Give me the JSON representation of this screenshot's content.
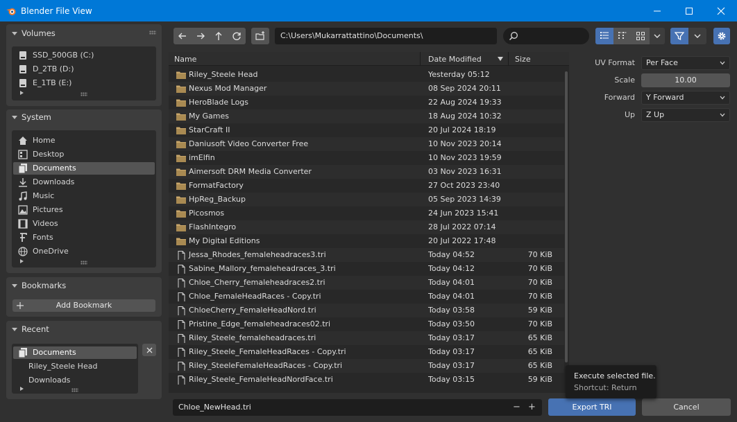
{
  "window": {
    "title": "Blender File View",
    "minimize": "—",
    "maximize": "☐",
    "close": "✕"
  },
  "volumes": {
    "header": "Volumes",
    "items": [
      "SSD_500GB (C:)",
      "D_2TB (D:)",
      "E_1TB (E:)"
    ]
  },
  "system": {
    "header": "System",
    "items": [
      {
        "label": "Home",
        "icon": "home-icon"
      },
      {
        "label": "Desktop",
        "icon": "desktop-icon"
      },
      {
        "label": "Documents",
        "icon": "documents-icon"
      },
      {
        "label": "Downloads",
        "icon": "downloads-icon"
      },
      {
        "label": "Music",
        "icon": "music-icon"
      },
      {
        "label": "Pictures",
        "icon": "pictures-icon"
      },
      {
        "label": "Videos",
        "icon": "videos-icon"
      },
      {
        "label": "Fonts",
        "icon": "fonts-icon"
      },
      {
        "label": "OneDrive",
        "icon": "onedrive-icon"
      }
    ],
    "active_index": 2
  },
  "bookmarks": {
    "header": "Bookmarks",
    "add_label": "Add Bookmark"
  },
  "recent": {
    "header": "Recent",
    "items": [
      "Documents",
      "Riley_Steele  Head",
      "Downloads"
    ]
  },
  "toolbar": {
    "path": "C:\\Users\\Mukarrattattino\\Documents\\",
    "search_placeholder": ""
  },
  "columns": {
    "name": "Name",
    "date": "Date Modified",
    "size": "Size"
  },
  "files": [
    {
      "name": "Riley_Steele  Head",
      "date": "Yesterday 05:12",
      "size": "",
      "folder": true
    },
    {
      "name": "Nexus Mod Manager",
      "date": "08 Sep 2024 20:11",
      "size": "",
      "folder": true
    },
    {
      "name": "HeroBlade Logs",
      "date": "22 Aug 2024 19:33",
      "size": "",
      "folder": true
    },
    {
      "name": "My Games",
      "date": "18 Aug 2024 10:32",
      "size": "",
      "folder": true
    },
    {
      "name": "StarCraft II",
      "date": "20 Jul 2024 18:19",
      "size": "",
      "folder": true
    },
    {
      "name": "Daniusoft Video Converter Free",
      "date": "10 Nov 2023 20:14",
      "size": "",
      "folder": true
    },
    {
      "name": "imElfin",
      "date": "10 Nov 2023 19:59",
      "size": "",
      "folder": true
    },
    {
      "name": "Aimersoft DRM Media Converter",
      "date": "03 Nov 2023 16:31",
      "size": "",
      "folder": true
    },
    {
      "name": "FormatFactory",
      "date": "27 Oct 2023 23:40",
      "size": "",
      "folder": true
    },
    {
      "name": "HpReg_Backup",
      "date": "05 Sep 2023 14:39",
      "size": "",
      "folder": true
    },
    {
      "name": "Picosmos",
      "date": "24 Jun 2023 15:41",
      "size": "",
      "folder": true
    },
    {
      "name": "FlashIntegro",
      "date": "28 Jul 2022 07:14",
      "size": "",
      "folder": true
    },
    {
      "name": "My Digital Editions",
      "date": "20 Jul 2022 17:48",
      "size": "",
      "folder": true
    },
    {
      "name": "Jessa_Rhodes_femaleheadraces3.tri",
      "date": "Today 04:52",
      "size": "70 KiB",
      "folder": false
    },
    {
      "name": "Sabine_Mallory_femaleheadraces_3.tri",
      "date": "Today 04:12",
      "size": "70 KiB",
      "folder": false
    },
    {
      "name": "Chloe_Cherry_femaleheadraces2.tri",
      "date": "Today 04:01",
      "size": "70 KiB",
      "folder": false
    },
    {
      "name": "Chloe_FemaleHeadRaces - Copy.tri",
      "date": "Today 04:01",
      "size": "70 KiB",
      "folder": false
    },
    {
      "name": "ChloeCherry_FemaleHeadNord.tri",
      "date": "Today 03:58",
      "size": "59 KiB",
      "folder": false
    },
    {
      "name": "Pristine_Edge_femaleheadraces02.tri",
      "date": "Today 03:50",
      "size": "70 KiB",
      "folder": false
    },
    {
      "name": "Riley_Steele_femaleheadraces.tri",
      "date": "Today 03:17",
      "size": "65 KiB",
      "folder": false
    },
    {
      "name": "Riley_Steele_FemaleHeadRaces - Copy.tri",
      "date": "Today 03:17",
      "size": "65 KiB",
      "folder": false
    },
    {
      "name": "Riley_SteeleFemaleHeadRaces - Copy.tri",
      "date": "Today 03:17",
      "size": "65 KiB",
      "folder": false
    },
    {
      "name": "Riley_Steele_FemaleHeadNordFace.tri",
      "date": "Today 03:15",
      "size": "59 KiB",
      "folder": false
    }
  ],
  "options": {
    "uv_format_label": "UV Format",
    "uv_format_value": "Per Face",
    "scale_label": "Scale",
    "scale_value": "10.00",
    "forward_label": "Forward",
    "forward_value": "Y Forward",
    "up_label": "Up",
    "up_value": "Z Up"
  },
  "footer": {
    "filename": "Chloe_NewHead.tri",
    "minus": "−",
    "plus": "+",
    "export_label": "Export TRI",
    "cancel_label": "Cancel"
  },
  "tooltip": {
    "line1": "Execute selected file.",
    "line2": "Shortcut: Return"
  },
  "colors": {
    "titlebar": "#0078d7",
    "accent": "#4772b3",
    "folder": "#c8a66a"
  }
}
